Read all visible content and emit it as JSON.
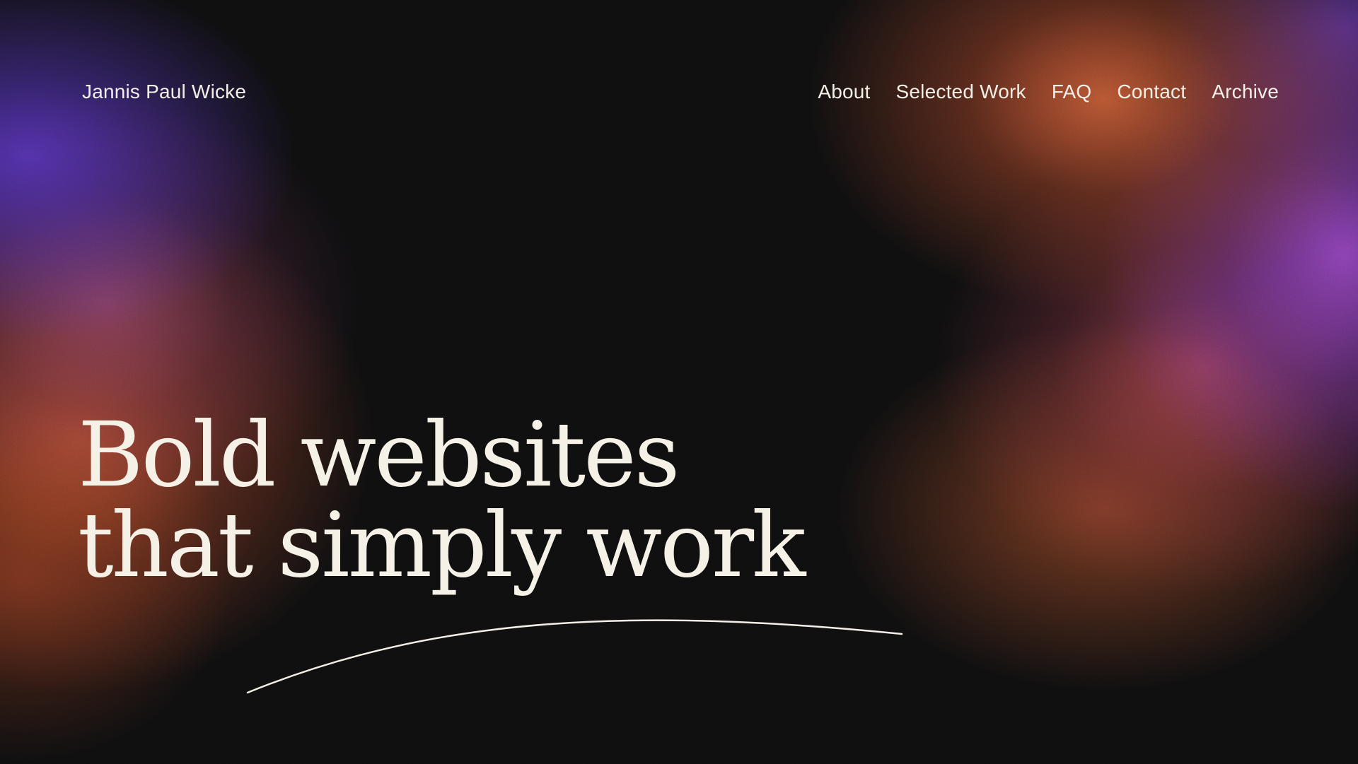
{
  "header": {
    "brand": "Jannis Paul Wicke",
    "nav": [
      {
        "label": "About"
      },
      {
        "label": "Selected Work"
      },
      {
        "label": "FAQ"
      },
      {
        "label": "Contact"
      },
      {
        "label": "Archive"
      }
    ]
  },
  "hero": {
    "headline_line1": "Bold websites",
    "headline_line2": "that simply work"
  },
  "colors": {
    "background": "#0e0e0f",
    "text": "#f4efe6",
    "accent_orange": "#d25f37",
    "accent_purple": "#9646c8"
  }
}
